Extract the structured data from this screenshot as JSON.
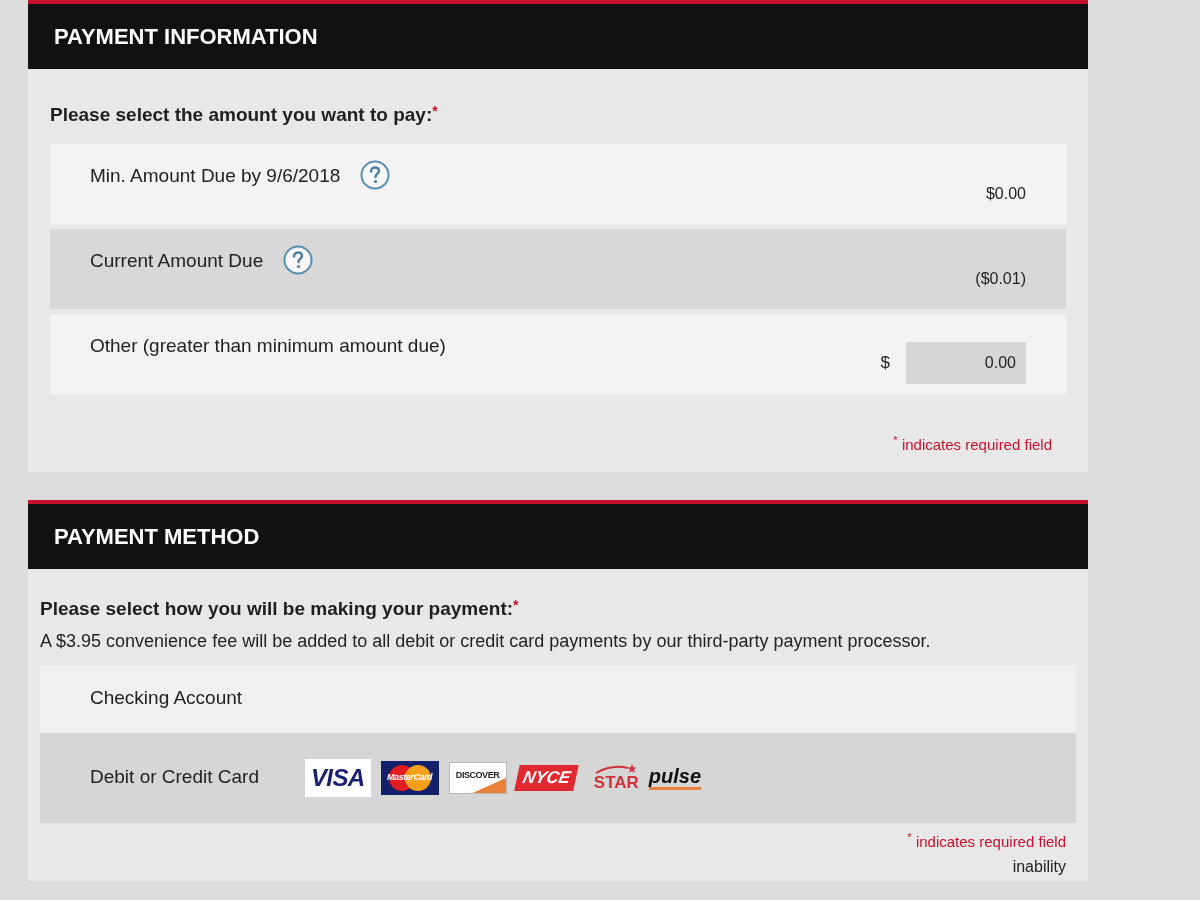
{
  "payment_information": {
    "title": "PAYMENT INFORMATION",
    "prompt": {
      "text": "Please select the amount you want to pay:",
      "required_mark": "*"
    },
    "options": [
      {
        "kind": "amount",
        "label": "Min. Amount Due by 9/6/2018",
        "help": true,
        "amount": "$0.00"
      },
      {
        "kind": "amount",
        "label": "Current Amount Due",
        "help": true,
        "amount": "($0.01)"
      },
      {
        "kind": "input",
        "label": "Other (greater than minimum amount due)",
        "help": false,
        "currency": "$",
        "value": "0.00"
      }
    ],
    "required_note": "$^{*}$ indicates required field"
  },
  "payment_method": {
    "title": "PAYMENT METHOD",
    "prompt": {
      "text": "Please select how you will be making your payment:",
      "required_mark": "*"
    },
    "fee_notice": "A $3.95 convenience fee will be added to all debit or credit card payments by our third-party payment processor.",
    "options": [
      {
        "kind": "plain",
        "label": "Checking Account"
      },
      {
        "kind": "cards",
        "label": "Debit or Credit Card",
        "card_logos": [
          {
            "kind": "visa",
            "label": "VISA"
          },
          {
            "kind": "mastercard",
            "label": "MasterCard"
          },
          {
            "kind": "discover",
            "label": "DISCOVER"
          },
          {
            "kind": "nyce",
            "label": "NYCE"
          },
          {
            "kind": "star",
            "label": "STAR"
          },
          {
            "kind": "pulse",
            "label": "pulse"
          }
        ]
      }
    ],
    "required_note": "$^{*}$ indicates required field"
  },
  "footer_fragment": "inability"
}
